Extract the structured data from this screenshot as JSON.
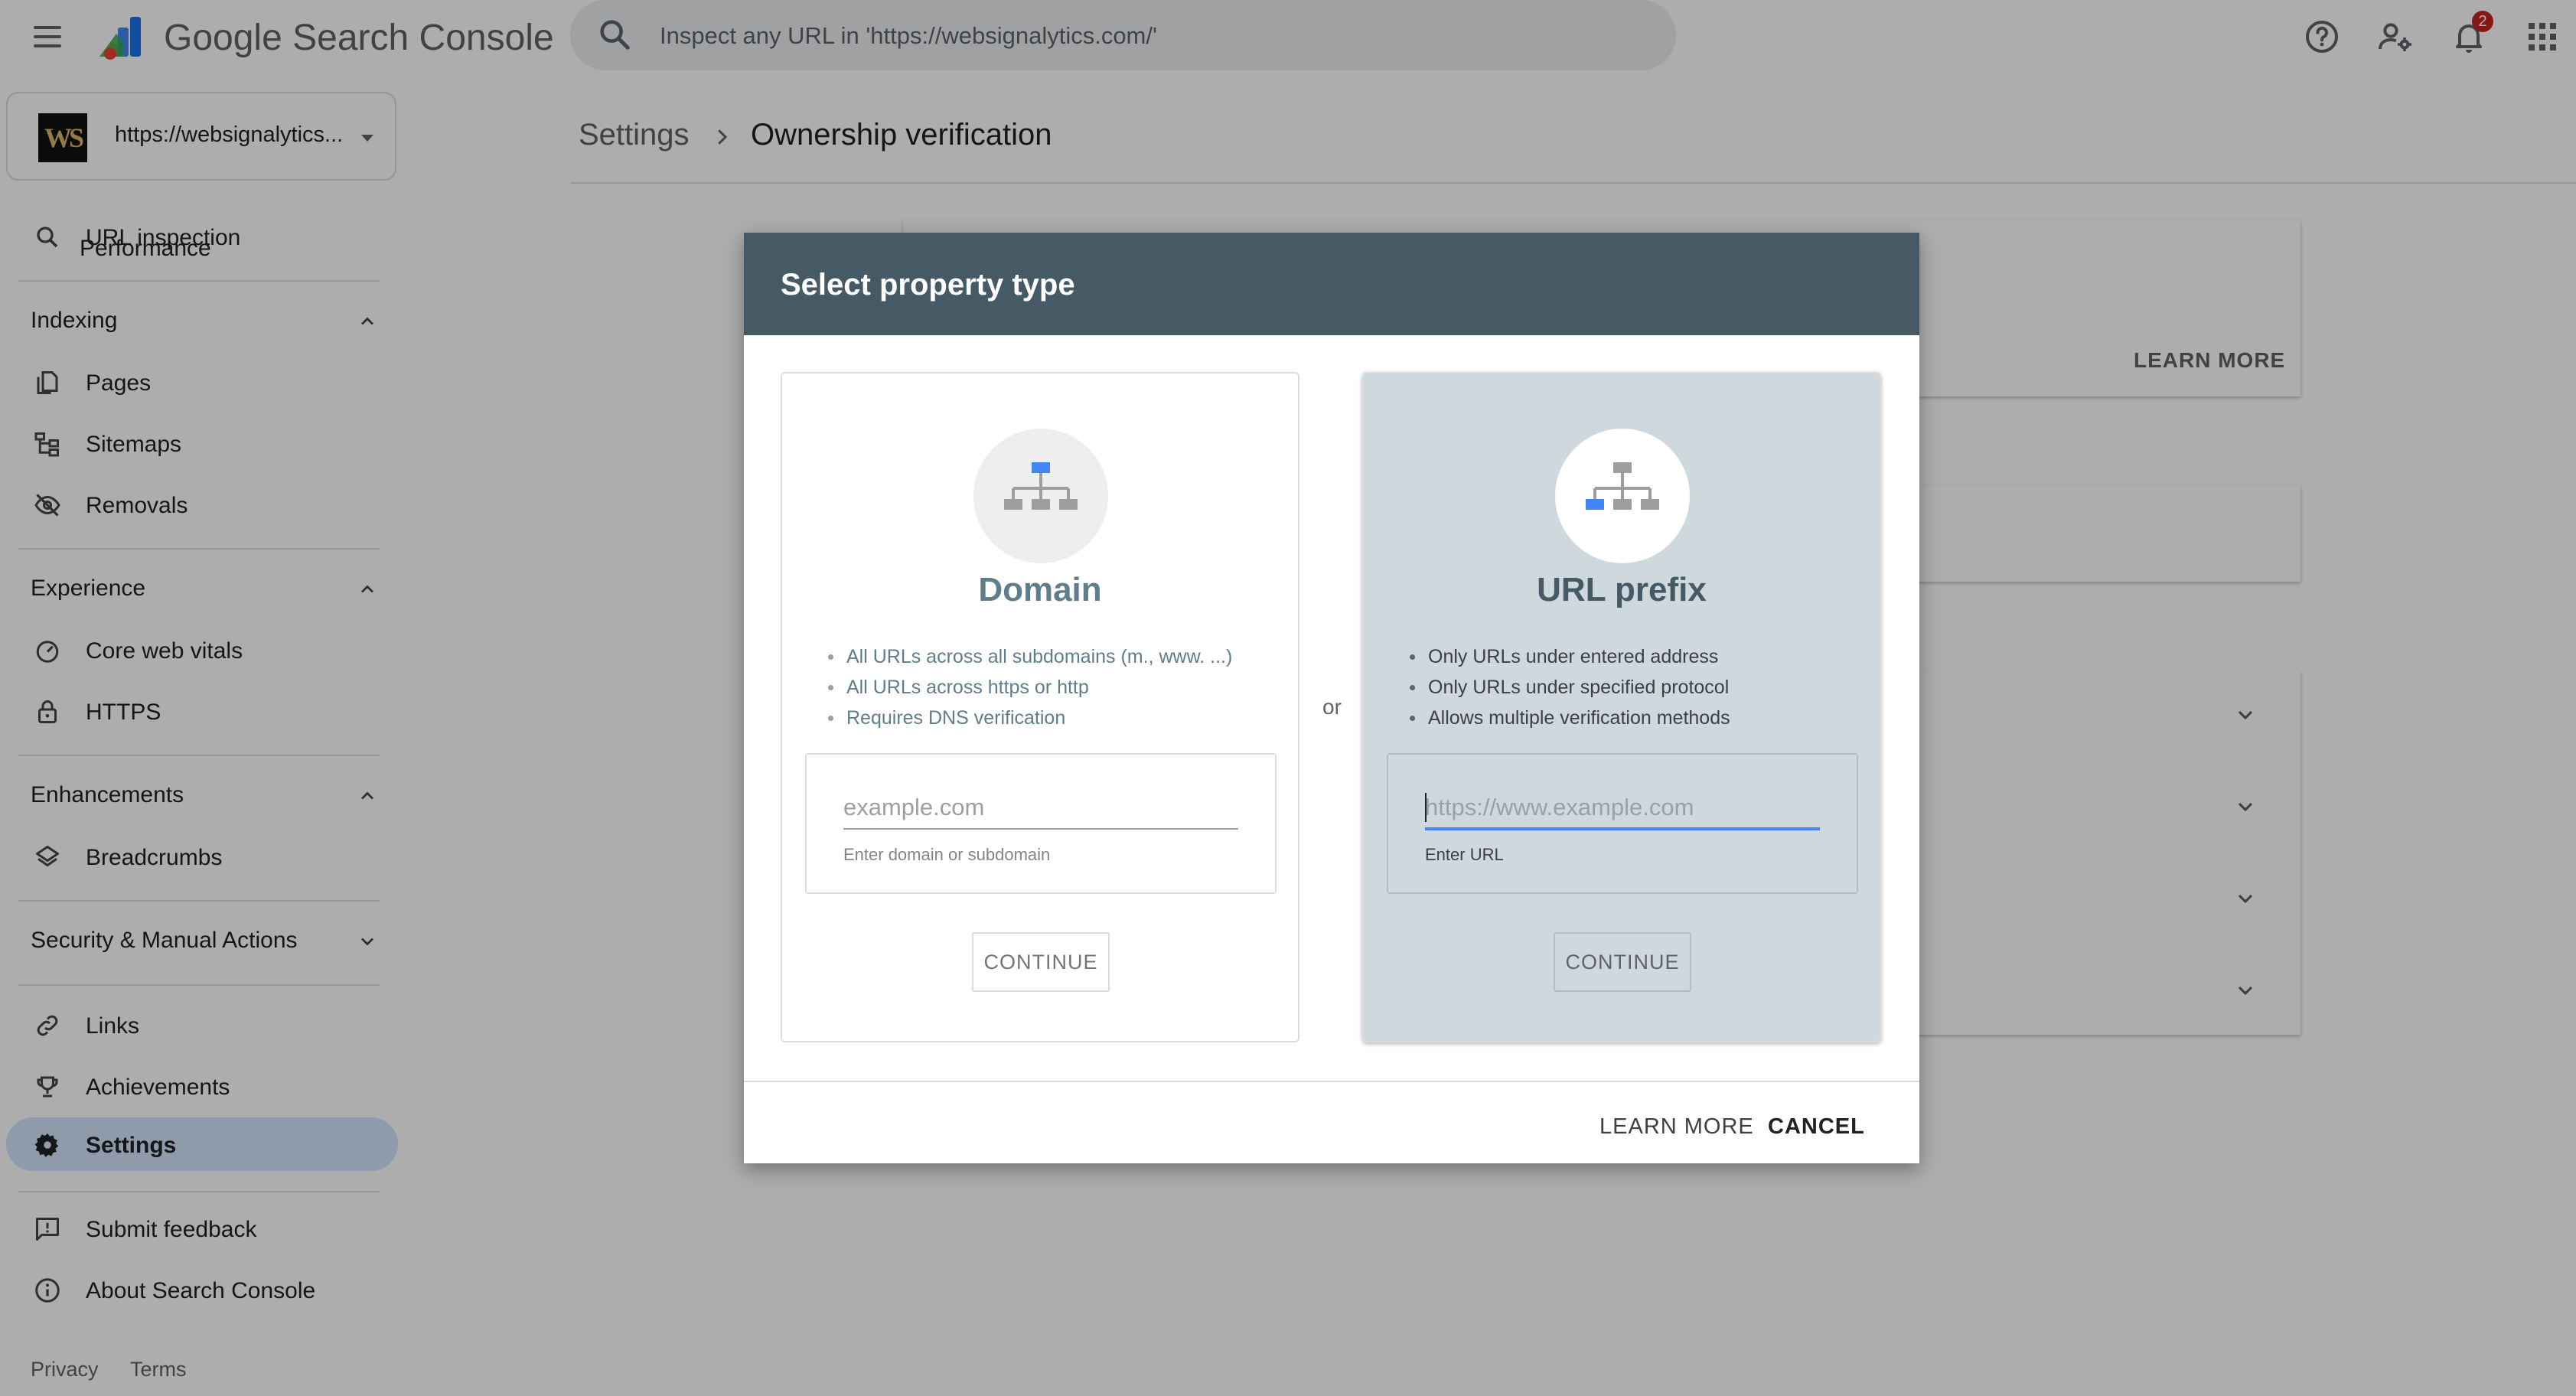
{
  "header": {
    "app_title": "Google Search Console",
    "search_placeholder": "Inspect any URL in 'https://websignalytics.com/'",
    "notification_count": "2",
    "icons": [
      "menu-icon",
      "search-console-logo",
      "search-icon",
      "help-icon",
      "manage-users-icon",
      "notifications-icon",
      "apps-icon"
    ]
  },
  "sidebar": {
    "property": {
      "logo_text": "WS",
      "url": "https://websignalytics..."
    },
    "clipped_item": "Performance",
    "url_inspection": "URL inspection",
    "sections": {
      "indexing": {
        "label": "Indexing",
        "items": [
          "Pages",
          "Sitemaps",
          "Removals"
        ]
      },
      "experience": {
        "label": "Experience",
        "items": [
          "Core web vitals",
          "HTTPS"
        ]
      },
      "enhancements": {
        "label": "Enhancements",
        "items": [
          "Breadcrumbs"
        ]
      },
      "security": {
        "label": "Security & Manual Actions"
      }
    },
    "links": "Links",
    "achievements": "Achievements",
    "settings": "Settings",
    "submit_feedback": "Submit feedback",
    "about": "About Search Console",
    "footer": {
      "privacy": "Privacy",
      "terms": "Terms"
    }
  },
  "main": {
    "breadcrumb": {
      "parent": "Settings",
      "current": "Ownership verification"
    },
    "background_learn_more": "LEARN MORE"
  },
  "dialog": {
    "title": "Select property type",
    "or_label": "or",
    "domain": {
      "title": "Domain",
      "features": [
        "All URLs across all subdomains (m., www. ...)",
        "All URLs across https or http",
        "Requires DNS verification"
      ],
      "placeholder": "example.com",
      "value": "",
      "helper": "Enter domain or subdomain",
      "continue": "CONTINUE"
    },
    "url_prefix": {
      "title": "URL prefix",
      "features": [
        "Only URLs under entered address",
        "Only URLs under specified protocol",
        "Allows multiple verification methods"
      ],
      "placeholder": "https://www.example.com",
      "value": "",
      "helper": "Enter URL",
      "continue": "CONTINUE"
    },
    "learn_more": "LEARN MORE",
    "cancel": "CANCEL"
  },
  "colors": {
    "dialog_header": "#455a64",
    "selected_card": "#cfd8dc",
    "active_nav": "#d3e3fd",
    "focus_blue": "#4285f4",
    "sitemap_blue": "#4285f4"
  }
}
